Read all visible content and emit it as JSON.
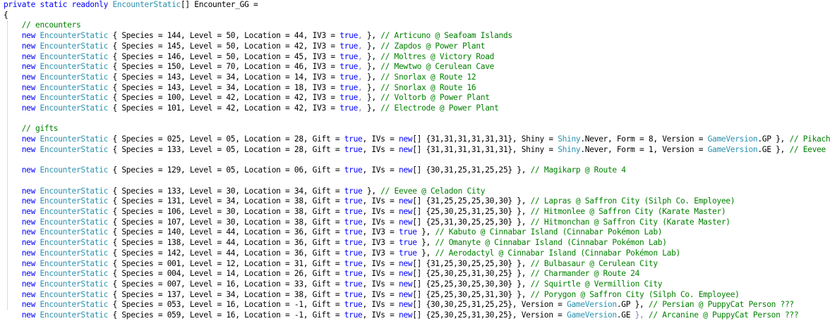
{
  "colors": {
    "keyword": "#0000ff",
    "type": "#2b91af",
    "comment": "#008000",
    "text": "#000000",
    "paren": "#8080c0"
  },
  "lines": [
    [
      [
        "kw",
        "private static readonly "
      ],
      [
        "ty",
        "EncounterStatic"
      ],
      [
        "tx",
        "[] Encounter_GG ="
      ]
    ],
    [
      [
        "tx",
        "{"
      ]
    ],
    [
      [
        "tx",
        "    "
      ],
      [
        "cm",
        "// encounters"
      ]
    ],
    [
      [
        "tx",
        "    "
      ],
      [
        "kw",
        "new "
      ],
      [
        "ty",
        "EncounterStatic"
      ],
      [
        "tx",
        " { Species = 144, Level = 50, Location = 44, IV3 = "
      ],
      [
        "kw",
        "true"
      ],
      [
        "pa",
        ", "
      ],
      [
        "tx",
        "}, "
      ],
      [
        "cm",
        "// Articuno @ Seafoam Islands"
      ]
    ],
    [
      [
        "tx",
        "    "
      ],
      [
        "kw",
        "new "
      ],
      [
        "ty",
        "EncounterStatic"
      ],
      [
        "tx",
        " { Species = 145, Level = 50, Location = 42, IV3 = "
      ],
      [
        "kw",
        "true"
      ],
      [
        "pa",
        ", "
      ],
      [
        "tx",
        "}, "
      ],
      [
        "cm",
        "// Zapdos @ Power Plant"
      ]
    ],
    [
      [
        "tx",
        "    "
      ],
      [
        "kw",
        "new "
      ],
      [
        "ty",
        "EncounterStatic"
      ],
      [
        "tx",
        " { Species = 146, Level = 50, Location = 45, IV3 = "
      ],
      [
        "kw",
        "true"
      ],
      [
        "pa",
        ", "
      ],
      [
        "tx",
        "}, "
      ],
      [
        "cm",
        "// Moltres @ Victory Road"
      ]
    ],
    [
      [
        "tx",
        "    "
      ],
      [
        "kw",
        "new "
      ],
      [
        "ty",
        "EncounterStatic"
      ],
      [
        "tx",
        " { Species = 150, Level = 70, Location = 46, IV3 = "
      ],
      [
        "kw",
        "true"
      ],
      [
        "pa",
        ", "
      ],
      [
        "tx",
        "}, "
      ],
      [
        "cm",
        "// Mewtwo @ Cerulean Cave"
      ]
    ],
    [
      [
        "tx",
        "    "
      ],
      [
        "kw",
        "new "
      ],
      [
        "ty",
        "EncounterStatic"
      ],
      [
        "tx",
        " { Species = 143, Level = 34, Location = 14, IV3 = "
      ],
      [
        "kw",
        "true"
      ],
      [
        "pa",
        ", "
      ],
      [
        "tx",
        "}, "
      ],
      [
        "cm",
        "// Snorlax @ Route 12"
      ]
    ],
    [
      [
        "tx",
        "    "
      ],
      [
        "kw",
        "new "
      ],
      [
        "ty",
        "EncounterStatic"
      ],
      [
        "tx",
        " { Species = 143, Level = 34, Location = 18, IV3 = "
      ],
      [
        "kw",
        "true"
      ],
      [
        "pa",
        ", "
      ],
      [
        "tx",
        "}, "
      ],
      [
        "cm",
        "// Snorlax @ Route 16"
      ]
    ],
    [
      [
        "tx",
        "    "
      ],
      [
        "kw",
        "new "
      ],
      [
        "ty",
        "EncounterStatic"
      ],
      [
        "tx",
        " { Species = 100, Level = 42, Location = 42, IV3 = "
      ],
      [
        "kw",
        "true"
      ],
      [
        "pa",
        ", "
      ],
      [
        "tx",
        "}, "
      ],
      [
        "cm",
        "// Voltorb @ Power Plant"
      ]
    ],
    [
      [
        "tx",
        "    "
      ],
      [
        "kw",
        "new "
      ],
      [
        "ty",
        "EncounterStatic"
      ],
      [
        "tx",
        " { Species = 101, Level = 42, Location = 42, IV3 = "
      ],
      [
        "kw",
        "true"
      ],
      [
        "pa",
        ", "
      ],
      [
        "tx",
        "}, "
      ],
      [
        "cm",
        "// Electrode @ Power Plant"
      ]
    ],
    [],
    [
      [
        "tx",
        "    "
      ],
      [
        "cm",
        "// gifts"
      ]
    ],
    [
      [
        "tx",
        "    "
      ],
      [
        "kw",
        "new "
      ],
      [
        "ty",
        "EncounterStatic"
      ],
      [
        "tx",
        " { Species = 025, Level = 05, Location = 28, Gift = "
      ],
      [
        "kw",
        "true"
      ],
      [
        "tx",
        ", IVs = "
      ],
      [
        "kw",
        "new"
      ],
      [
        "tx",
        "[] {31,31,31,31,31,31}, Shiny = "
      ],
      [
        "ty",
        "Shiny"
      ],
      [
        "tx",
        ".Never, Form = 8, Version = "
      ],
      [
        "ty",
        "GameVersion"
      ],
      [
        "tx",
        ".GP }, "
      ],
      [
        "cm",
        "// Pikachu @ Pallet Town"
      ]
    ],
    [
      [
        "tx",
        "    "
      ],
      [
        "kw",
        "new "
      ],
      [
        "ty",
        "EncounterStatic"
      ],
      [
        "tx",
        " { Species = 133, Level = 05, Location = 28, Gift = "
      ],
      [
        "kw",
        "true"
      ],
      [
        "tx",
        ", IVs = "
      ],
      [
        "kw",
        "new"
      ],
      [
        "tx",
        "[] {31,31,31,31,31,31}, Shiny = "
      ],
      [
        "ty",
        "Shiny"
      ],
      [
        "tx",
        ".Never, Form = 1, Version = "
      ],
      [
        "ty",
        "GameVersion"
      ],
      [
        "tx",
        ".GE }, "
      ],
      [
        "cm",
        "// Eevee @ Pallet Town"
      ]
    ],
    [],
    [
      [
        "tx",
        "    "
      ],
      [
        "kw",
        "new "
      ],
      [
        "ty",
        "EncounterStatic"
      ],
      [
        "tx",
        " { Species = 129, Level = 05, Location = 06, Gift = "
      ],
      [
        "kw",
        "true"
      ],
      [
        "tx",
        ", IVs = "
      ],
      [
        "kw",
        "new"
      ],
      [
        "tx",
        "[] {30,31,25,31,25,25} }, "
      ],
      [
        "cm",
        "// Magikarp @ Route 4"
      ]
    ],
    [],
    [
      [
        "tx",
        "    "
      ],
      [
        "kw",
        "new "
      ],
      [
        "ty",
        "EncounterStatic"
      ],
      [
        "tx",
        " { Species = 133, Level = 30, Location = 34, Gift = "
      ],
      [
        "kw",
        "true"
      ],
      [
        "tx",
        " }, "
      ],
      [
        "cm",
        "// Eevee @ Celadon City"
      ]
    ],
    [
      [
        "tx",
        "    "
      ],
      [
        "kw",
        "new "
      ],
      [
        "ty",
        "EncounterStatic"
      ],
      [
        "tx",
        " { Species = 131, Level = 34, Location = 38, Gift = "
      ],
      [
        "kw",
        "true"
      ],
      [
        "tx",
        ", IVs = "
      ],
      [
        "kw",
        "new"
      ],
      [
        "tx",
        "[] {31,25,25,25,30,30} }, "
      ],
      [
        "cm",
        "// Lapras @ Saffron City (Silph Co. Employee)"
      ]
    ],
    [
      [
        "tx",
        "    "
      ],
      [
        "kw",
        "new "
      ],
      [
        "ty",
        "EncounterStatic"
      ],
      [
        "tx",
        " { Species = 106, Level = 30, Location = 38, Gift = "
      ],
      [
        "kw",
        "true"
      ],
      [
        "tx",
        ", IVs = "
      ],
      [
        "kw",
        "new"
      ],
      [
        "tx",
        "[] {25,30,25,31,25,30} }, "
      ],
      [
        "cm",
        "// Hitmonlee @ Saffron City (Karate Master)"
      ]
    ],
    [
      [
        "tx",
        "    "
      ],
      [
        "kw",
        "new "
      ],
      [
        "ty",
        "EncounterStatic"
      ],
      [
        "tx",
        " { Species = 107, Level = 30, Location = 38, Gift = "
      ],
      [
        "kw",
        "true"
      ],
      [
        "tx",
        ", IVs = "
      ],
      [
        "kw",
        "new"
      ],
      [
        "tx",
        "[] {25,31,30,25,25,30} }, "
      ],
      [
        "cm",
        "// Hitmonchan @ Saffron City (Karate Master)"
      ]
    ],
    [
      [
        "tx",
        "    "
      ],
      [
        "kw",
        "new "
      ],
      [
        "ty",
        "EncounterStatic"
      ],
      [
        "tx",
        " { Species = 140, Level = 44, Location = 36, Gift = "
      ],
      [
        "kw",
        "true"
      ],
      [
        "tx",
        ", IV3 = "
      ],
      [
        "kw",
        "true"
      ],
      [
        "tx",
        " }, "
      ],
      [
        "cm",
        "// Kabuto @ Cinnabar Island (Cinnabar Pokémon Lab)"
      ]
    ],
    [
      [
        "tx",
        "    "
      ],
      [
        "kw",
        "new "
      ],
      [
        "ty",
        "EncounterStatic"
      ],
      [
        "tx",
        " { Species = 138, Level = 44, Location = 36, Gift = "
      ],
      [
        "kw",
        "true"
      ],
      [
        "tx",
        ", IV3 = "
      ],
      [
        "kw",
        "true"
      ],
      [
        "tx",
        " }, "
      ],
      [
        "cm",
        "// Omanyte @ Cinnabar Island (Cinnabar Pokémon Lab)"
      ]
    ],
    [
      [
        "tx",
        "    "
      ],
      [
        "kw",
        "new "
      ],
      [
        "ty",
        "EncounterStatic"
      ],
      [
        "tx",
        " { Species = 142, Level = 44, Location = 36, Gift = "
      ],
      [
        "kw",
        "true"
      ],
      [
        "tx",
        ", IV3 = "
      ],
      [
        "kw",
        "true"
      ],
      [
        "tx",
        " }, "
      ],
      [
        "cm",
        "// Aerodactyl @ Cinnabar Island (Cinnabar Pokémon Lab)"
      ]
    ],
    [
      [
        "tx",
        "    "
      ],
      [
        "kw",
        "new "
      ],
      [
        "ty",
        "EncounterStatic"
      ],
      [
        "tx",
        " { Species = 001, Level = 12, Location = 31, Gift = "
      ],
      [
        "kw",
        "true"
      ],
      [
        "tx",
        ", IVs = "
      ],
      [
        "kw",
        "new"
      ],
      [
        "tx",
        "[] {31,25,30,25,25,30} }, "
      ],
      [
        "cm",
        "// Bulbasaur @ Cerulean City"
      ]
    ],
    [
      [
        "tx",
        "    "
      ],
      [
        "kw",
        "new "
      ],
      [
        "ty",
        "EncounterStatic"
      ],
      [
        "tx",
        " { Species = 004, Level = 14, Location = 26, Gift = "
      ],
      [
        "kw",
        "true"
      ],
      [
        "tx",
        ", IVs = "
      ],
      [
        "kw",
        "new"
      ],
      [
        "tx",
        "[] {25,30,25,31,30,25} }, "
      ],
      [
        "cm",
        "// Charmander @ Route 24"
      ]
    ],
    [
      [
        "tx",
        "    "
      ],
      [
        "kw",
        "new "
      ],
      [
        "ty",
        "EncounterStatic"
      ],
      [
        "tx",
        " { Species = 007, Level = 16, Location = 33, Gift = "
      ],
      [
        "kw",
        "true"
      ],
      [
        "tx",
        ", IVs = "
      ],
      [
        "kw",
        "new"
      ],
      [
        "tx",
        "[] {25,25,30,25,30,30} }, "
      ],
      [
        "cm",
        "// Squirtle @ Vermillion City"
      ]
    ],
    [
      [
        "tx",
        "    "
      ],
      [
        "kw",
        "new "
      ],
      [
        "ty",
        "EncounterStatic"
      ],
      [
        "tx",
        " { Species = 137, Level = 34, Location = 38, Gift = "
      ],
      [
        "kw",
        "true"
      ],
      [
        "tx",
        ", IVs = "
      ],
      [
        "kw",
        "new"
      ],
      [
        "tx",
        "[] {25,25,30,25,31,30} }, "
      ],
      [
        "cm",
        "// Porygon @ Saffron City (Silph Co. Employee)"
      ]
    ],
    [
      [
        "tx",
        "    "
      ],
      [
        "kw",
        "new "
      ],
      [
        "ty",
        "EncounterStatic"
      ],
      [
        "tx",
        " { Species = 053, Level = 16, Location = -1, Gift = "
      ],
      [
        "kw",
        "true"
      ],
      [
        "tx",
        ", IVs = "
      ],
      [
        "kw",
        "new"
      ],
      [
        "tx",
        "[] {30,30,25,31,25,25}, Version = "
      ],
      [
        "ty",
        "GameVersion"
      ],
      [
        "tx",
        ".GP }, "
      ],
      [
        "cm",
        "// Persian @ PuppyCat Person ???"
      ]
    ],
    [
      [
        "tx",
        "    "
      ],
      [
        "kw",
        "new "
      ],
      [
        "ty",
        "EncounterStatic"
      ],
      [
        "tx",
        " { Species = 059, Level = 16, Location = -1, Gift = "
      ],
      [
        "kw",
        "true"
      ],
      [
        "tx",
        ", IVs = "
      ],
      [
        "kw",
        "new"
      ],
      [
        "tx",
        "[] {25,30,25,31,30,25}, Version = "
      ],
      [
        "ty",
        "GameVersion"
      ],
      [
        "tx",
        ".GE "
      ],
      [
        "pa",
        "}, "
      ],
      [
        "cm",
        "// Arcanine @ PuppyCat Person ???"
      ]
    ],
    [
      [
        "tx",
        "};"
      ]
    ]
  ]
}
